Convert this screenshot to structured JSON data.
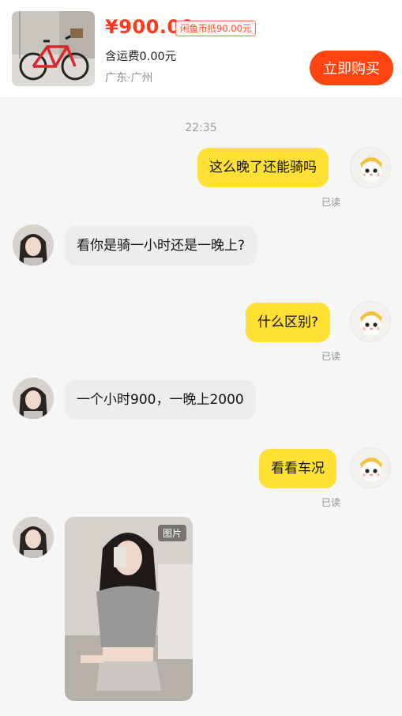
{
  "product": {
    "price": "¥900.00",
    "coin_discount": "闲鱼币抵90.00元",
    "shipping": "含运费0.00元",
    "location": "广东·广州",
    "buy_label": "立即购买"
  },
  "chat": {
    "timestamp": "22:35",
    "read_label": "已读",
    "messages": [
      {
        "from": "me",
        "text": "这么晚了还能骑吗"
      },
      {
        "from": "her",
        "text": "看你是骑一小时还是一晚上?"
      },
      {
        "from": "me",
        "text": "什么区别?"
      },
      {
        "from": "her",
        "text": "一个小时900，一晚上2000"
      },
      {
        "from": "me",
        "text": "看看车况"
      },
      {
        "from": "her",
        "type": "image",
        "tag": "图片"
      }
    ]
  },
  "colors": {
    "accent": "#ff4411",
    "my_bubble": "#ffe033",
    "their_bubble": "#ededed"
  }
}
